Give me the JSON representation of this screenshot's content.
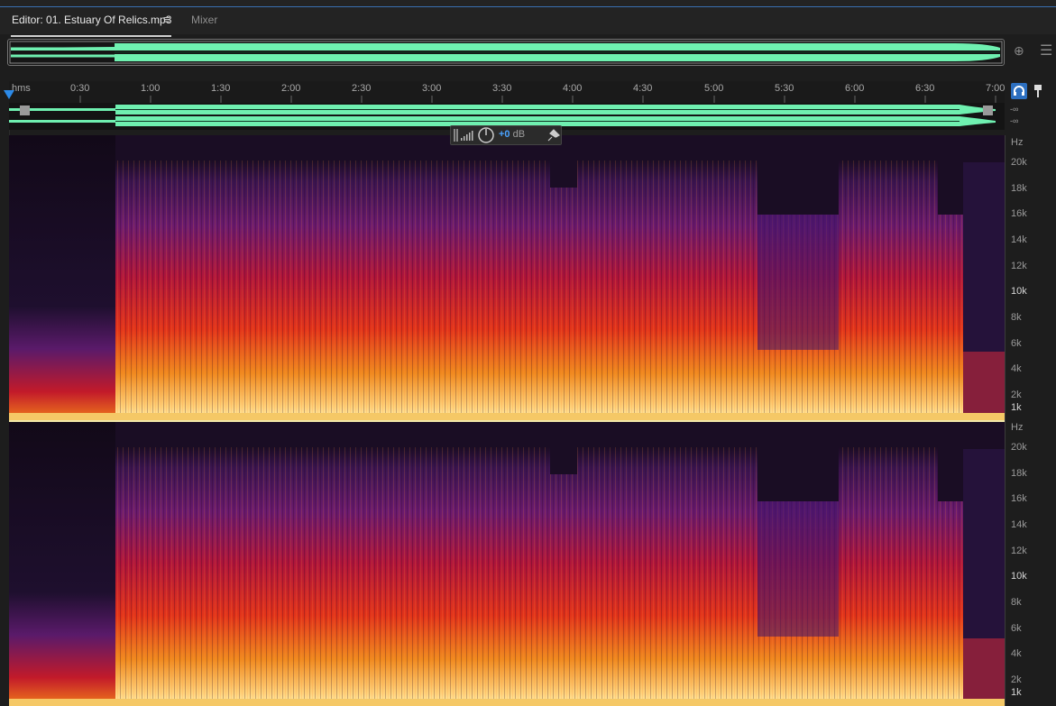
{
  "tabs": {
    "editor_label": "Editor: 01. Estuary Of Relics.mp3",
    "menu_glyph": "≡",
    "mixer_label": "Mixer"
  },
  "ruler": {
    "unit_label": "hms",
    "labels": [
      "0:30",
      "1:00",
      "1:30",
      "2:00",
      "2:30",
      "3:00",
      "3:30",
      "4:00",
      "4:30",
      "5:00",
      "5:30",
      "6:00",
      "6:30",
      "7:00"
    ]
  },
  "levels": {
    "top_db": "-∞",
    "bottom_db": "-∞"
  },
  "hud": {
    "gain_value": "+0",
    "gain_unit": "dB"
  },
  "frequency_axis": {
    "unit": "Hz",
    "labels": [
      "20k",
      "18k",
      "16k",
      "14k",
      "12k",
      "10k",
      "8k",
      "6k",
      "4k",
      "2k",
      "1k"
    ]
  },
  "colors": {
    "waveform": "#6ff0b0",
    "accent": "#2c8ae8",
    "spectrogram_low": "#1a0d24",
    "spectrogram_high": "#ffd27a"
  },
  "icons": [
    "zoom-icon",
    "panel-menu-icon",
    "headphones-icon",
    "marker-icon",
    "level-meter-icon",
    "gain-knob-icon",
    "pin-icon",
    "playhead-icon"
  ]
}
